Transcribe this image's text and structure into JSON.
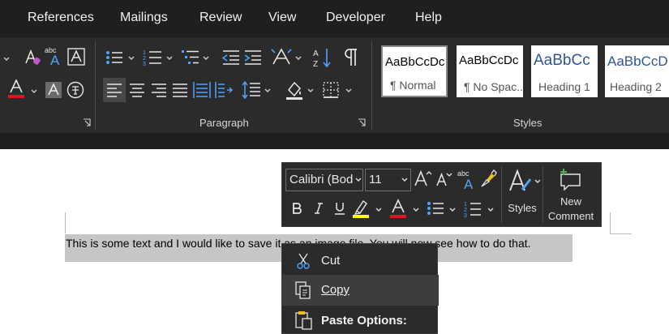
{
  "tabs": [
    "References",
    "Mailings",
    "Review",
    "View",
    "Developer",
    "Help"
  ],
  "ribbon": {
    "groups": {
      "paragraph": "Paragraph",
      "styles": "Styles"
    },
    "style_gallery": [
      {
        "sample": "AaBbCcDc",
        "name": "¶ Normal",
        "selected": true
      },
      {
        "sample": "AaBbCcDc",
        "name": "¶ No Spac...",
        "selected": false
      },
      {
        "sample": "AaBbCc",
        "name": "Heading 1",
        "selected": false
      },
      {
        "sample": "AaBbCcD",
        "name": "Heading 2",
        "selected": false
      }
    ],
    "font_color": "#e81123",
    "icons": [
      "text-effects-icon",
      "phonetic-guide-icon",
      "character-border-icon",
      "font-color-icon",
      "character-shading-icon",
      "enclose-characters-icon",
      "bullets-icon",
      "numbering-icon",
      "multilevel-list-icon",
      "decrease-indent-icon",
      "increase-indent-icon",
      "chinese-layout-icon",
      "sort-icon",
      "show-formatting-marks-icon",
      "align-left-icon",
      "center-icon",
      "align-right-icon",
      "justify-icon",
      "distributed-icon",
      "column-direction-icon",
      "line-spacing-icon",
      "shading-icon",
      "borders-icon",
      "dialog-launcher-icon"
    ]
  },
  "document": {
    "text": "This is some text and I would like to save it as an image file. You will now see how to do that."
  },
  "mini_toolbar": {
    "font_name": "Calibri (Bod",
    "font_size": "11",
    "styles_label": "Styles",
    "comment_label": [
      "New",
      "Comment"
    ],
    "highlight_color": "#ffff00",
    "font_color": "#e81123",
    "icons": [
      "grow-font-icon",
      "shrink-font-icon",
      "phonetic-guide-icon",
      "format-painter-icon",
      "styles-icon",
      "new-comment-icon",
      "bold-icon",
      "italic-icon",
      "underline-icon",
      "highlighter-icon",
      "font-color-icon",
      "bullets-icon",
      "numbering-icon"
    ]
  },
  "context_menu": {
    "items": [
      {
        "label": "Cut",
        "icon": "scissors-icon",
        "highlighted": false,
        "bold": false
      },
      {
        "label": "Copy",
        "icon": "copy-icon",
        "highlighted": true,
        "bold": false
      },
      {
        "label": "Paste Options:",
        "icon": "paste-icon",
        "highlighted": false,
        "bold": true
      }
    ]
  }
}
